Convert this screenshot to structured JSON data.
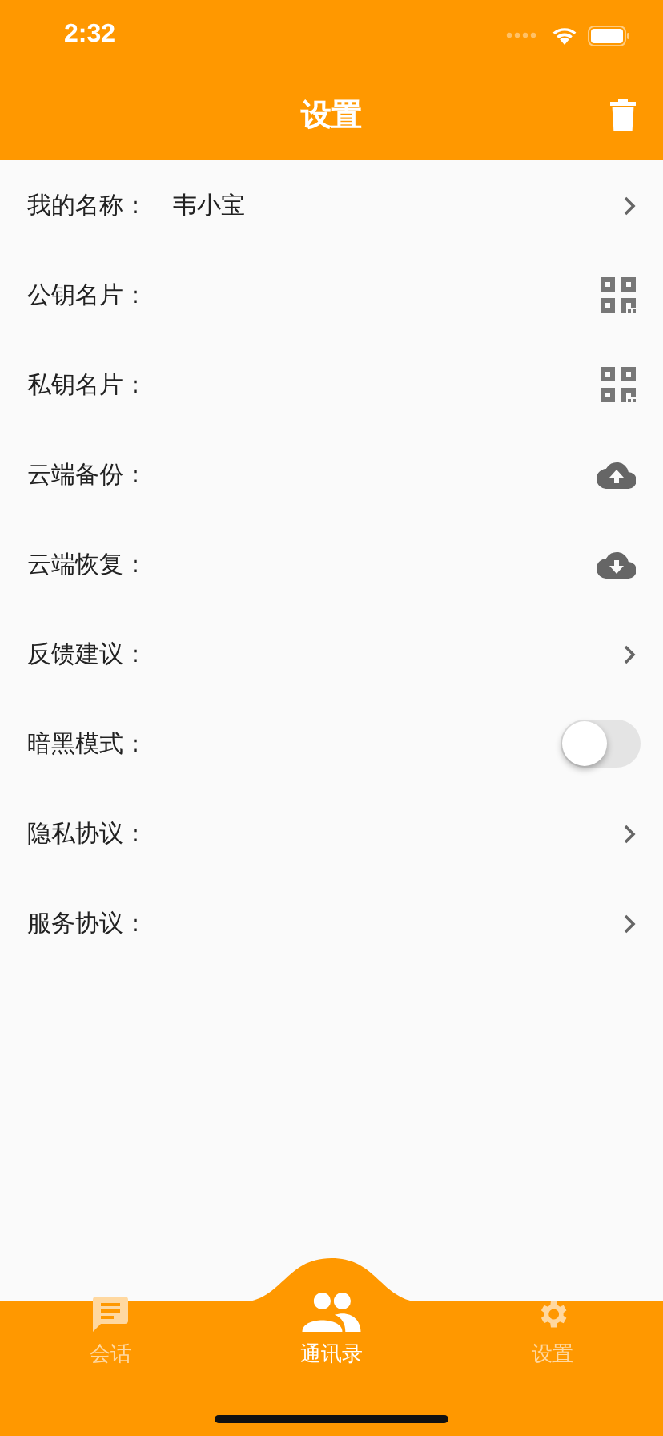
{
  "status_bar": {
    "time": "2:32"
  },
  "header": {
    "title": "设置"
  },
  "rows": [
    {
      "label": "我的名称：",
      "value": "韦小宝",
      "kind": "chevron"
    },
    {
      "label": "公钥名片：",
      "kind": "qr"
    },
    {
      "label": "私钥名片：",
      "kind": "qr"
    },
    {
      "label": "云端备份：",
      "kind": "upload"
    },
    {
      "label": "云端恢复：",
      "kind": "download"
    },
    {
      "label": "反馈建议：",
      "kind": "chevron"
    },
    {
      "label": "暗黑模式：",
      "kind": "toggle",
      "on": false
    },
    {
      "label": "隐私协议：",
      "kind": "chevron"
    },
    {
      "label": "服务协议：",
      "kind": "chevron"
    }
  ],
  "tabs": [
    {
      "label": "会话",
      "kind": "chat",
      "selected": false
    },
    {
      "label": "通讯录",
      "kind": "contacts",
      "selected": true
    },
    {
      "label": "设置",
      "kind": "settings",
      "selected": false
    }
  ]
}
